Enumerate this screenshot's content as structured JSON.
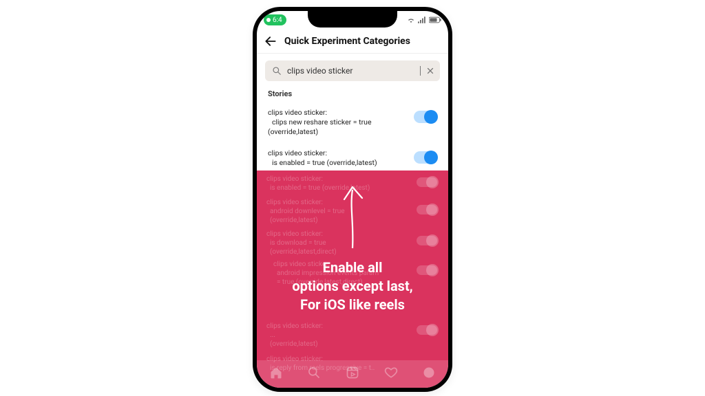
{
  "statusbar": {
    "time": "6:4"
  },
  "header": {
    "title": "Quick Experiment Categories"
  },
  "search": {
    "value": "clips video sticker"
  },
  "section": {
    "label": "Stories"
  },
  "rows": [
    {
      "t1": "clips video sticker:",
      "t2": "clips new reshare sticker = true",
      "t3": "(override,latest)"
    },
    {
      "t1": "clips video sticker:",
      "t2": "is enabled = true (override,latest)",
      "t3": ""
    }
  ],
  "overlay": {
    "line1": "Enable all",
    "line2": "options except last,",
    "line3": "For iOS like reels"
  }
}
